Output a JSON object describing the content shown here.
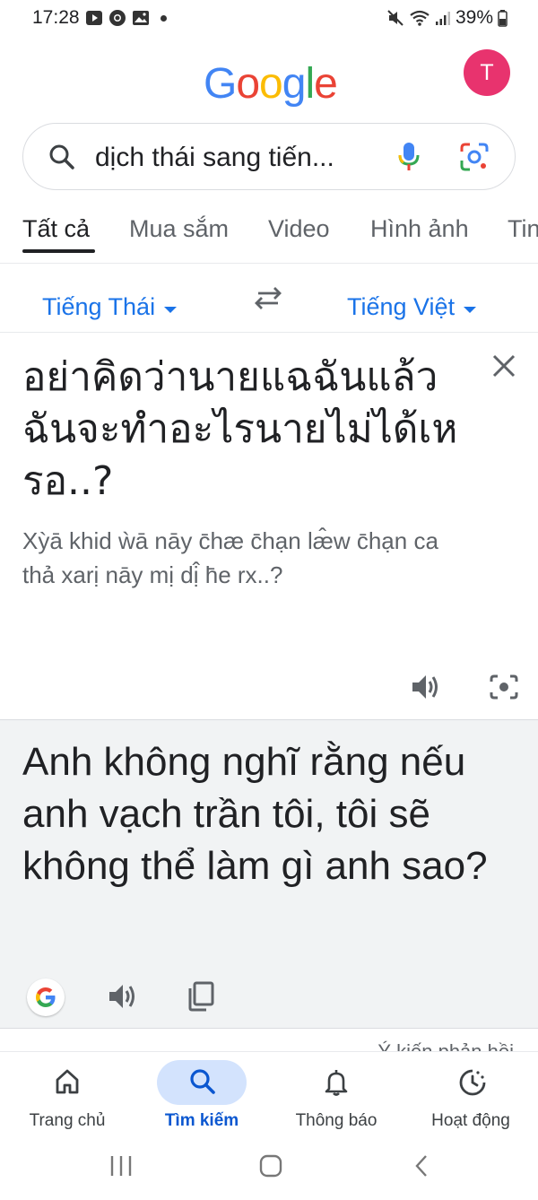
{
  "status_bar": {
    "time": "17:28",
    "battery": "39%"
  },
  "header": {
    "logo_letters": [
      "G",
      "o",
      "o",
      "g",
      "l",
      "e"
    ],
    "logo_colors": [
      "#4285F4",
      "#EA4335",
      "#FBBC05",
      "#4285F4",
      "#34A853",
      "#EA4335"
    ],
    "avatar_initial": "T",
    "avatar_color": "#e8336e"
  },
  "search": {
    "query": "dịch thái sang tiến..."
  },
  "tabs": [
    {
      "label": "Tất cả",
      "active": true
    },
    {
      "label": "Mua sắm",
      "active": false
    },
    {
      "label": "Video",
      "active": false
    },
    {
      "label": "Hình ảnh",
      "active": false
    },
    {
      "label": "Tin",
      "active": false
    }
  ],
  "translator": {
    "source_lang": "Tiếng Thái",
    "target_lang": "Tiếng Việt",
    "source_text": "อย่าคิดว่านายแฉฉันแล้วฉันจะทำอะไรนายไม่ได้เหรอ..?",
    "transliteration": "Xỳā khid ẁā nāy c̄hæ c̄hạn læ̂w c̄hạn ca thả xarị nāy mị dị̂ h̄e rx..?",
    "target_text": "Anh không nghĩ rằng nếu anh vạch trần tôi, tôi sẽ không thể làm gì anh sao?",
    "feedback_label": "Ý kiến phản hồi"
  },
  "bottom_nav": [
    {
      "label": "Trang chủ",
      "icon": "home-icon",
      "active": false
    },
    {
      "label": "Tìm kiếm",
      "icon": "search-icon",
      "active": true
    },
    {
      "label": "Thông báo",
      "icon": "bell-icon",
      "active": false
    },
    {
      "label": "Hoạt động",
      "icon": "activity-icon",
      "active": false
    }
  ],
  "colors": {
    "accent": "#1a73e8",
    "nav_active_bg": "#d3e3fd",
    "nav_active_text": "#0b57d0",
    "target_bg": "#f1f3f4"
  }
}
